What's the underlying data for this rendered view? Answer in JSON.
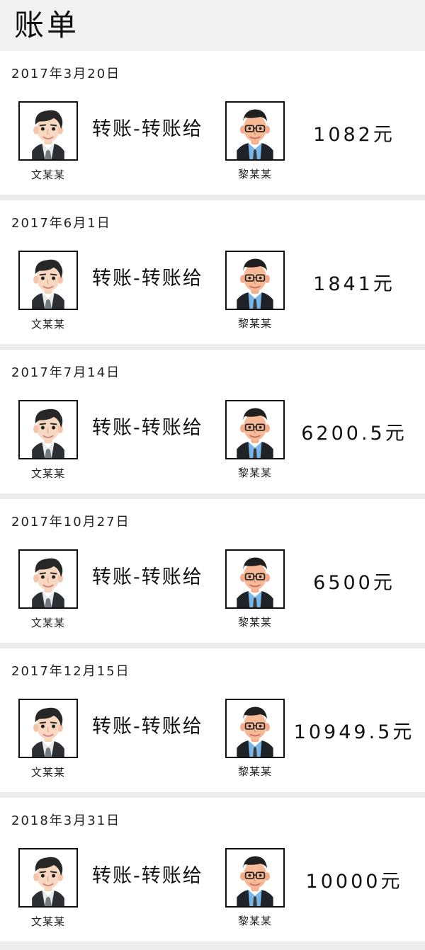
{
  "header": {
    "title": "账单"
  },
  "transactions": [
    {
      "date": "2017年3月20日",
      "sender": "文某某",
      "action": "转账-转账给",
      "receiver": "黎某某",
      "amount": "1082元"
    },
    {
      "date": "2017年6月1日",
      "sender": "文某某",
      "action": "转账-转账给",
      "receiver": "黎某某",
      "amount": "1841元"
    },
    {
      "date": "2017年7月14日",
      "sender": "文某某",
      "action": "转账-转账给",
      "receiver": "黎某某",
      "amount": "6200.5元"
    },
    {
      "date": "2017年10月27日",
      "sender": "文某某",
      "action": "转账-转账给",
      "receiver": "黎某某",
      "amount": "6500元"
    },
    {
      "date": "2017年12月15日",
      "sender": "文某某",
      "action": "转账-转账给",
      "receiver": "黎某某",
      "amount": "10949.5元"
    },
    {
      "date": "2018年3月31日",
      "sender": "文某某",
      "action": "转账-转账给",
      "receiver": "黎某某",
      "amount": "10000元"
    }
  ],
  "colors": {
    "page_background": "#ececec",
    "card_background": "#ffffff",
    "header_background": "#f2f2f2",
    "text": "#111111"
  },
  "icons": {
    "sender_avatar": "man-avatar-icon",
    "receiver_avatar": "man-with-glasses-avatar-icon"
  }
}
